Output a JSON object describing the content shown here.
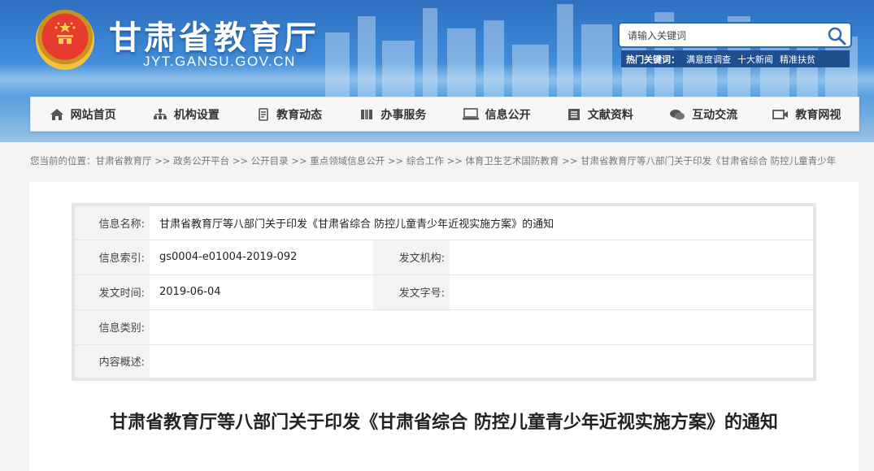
{
  "header": {
    "title": "甘肃省教育厅",
    "domain": "JYT.GANSU.GOV.CN"
  },
  "search": {
    "placeholder": "请输入关键词",
    "hot_label": "热门关键词：",
    "hot_words": [
      "满意度调查",
      "十大新闻",
      "精准扶贫"
    ]
  },
  "nav": {
    "items": [
      {
        "label": "网站首页",
        "icon": "home-icon"
      },
      {
        "label": "机构设置",
        "icon": "org-chart-icon"
      },
      {
        "label": "教育动态",
        "icon": "document-icon"
      },
      {
        "label": "办事服务",
        "icon": "service-icon"
      },
      {
        "label": "信息公开",
        "icon": "monitor-icon"
      },
      {
        "label": "文献资料",
        "icon": "book-icon"
      },
      {
        "label": "互动交流",
        "icon": "chat-icon"
      },
      {
        "label": "教育网视",
        "icon": "video-icon"
      }
    ]
  },
  "breadcrumb": "您当前的位置：甘肃省教育厅 >> 政务公开平台 >> 公开目录 >> 重点领域信息公开 >> 综合工作 >> 体育卫生艺术国防教育 >> 甘肃省教育厅等八部门关于印发《甘肃省综合 防控儿童青少年",
  "info": {
    "name_label": "信息名称:",
    "name_value": "甘肃省教育厅等八部门关于印发《甘肃省综合 防控儿童青少年近视实施方案》的通知",
    "index_label": "信息索引:",
    "index_value": "gs0004-e01004-2019-092",
    "org_label": "发文机构:",
    "org_value": "",
    "date_label": "发文时间:",
    "date_value": "2019-06-04",
    "docno_label": "发文字号:",
    "docno_value": "",
    "category_label": "信息类别:",
    "category_value": "",
    "summary_label": "内容概述:",
    "summary_value": ""
  },
  "document": {
    "title": "甘肃省教育厅等八部门关于印发《甘肃省综合 防控儿童青少年近视实施方案》的通知"
  },
  "colors": {
    "header_blue": "#3b86d6",
    "hotword_bar": "#1f4f8f",
    "search_border": "#2a6cb5"
  }
}
